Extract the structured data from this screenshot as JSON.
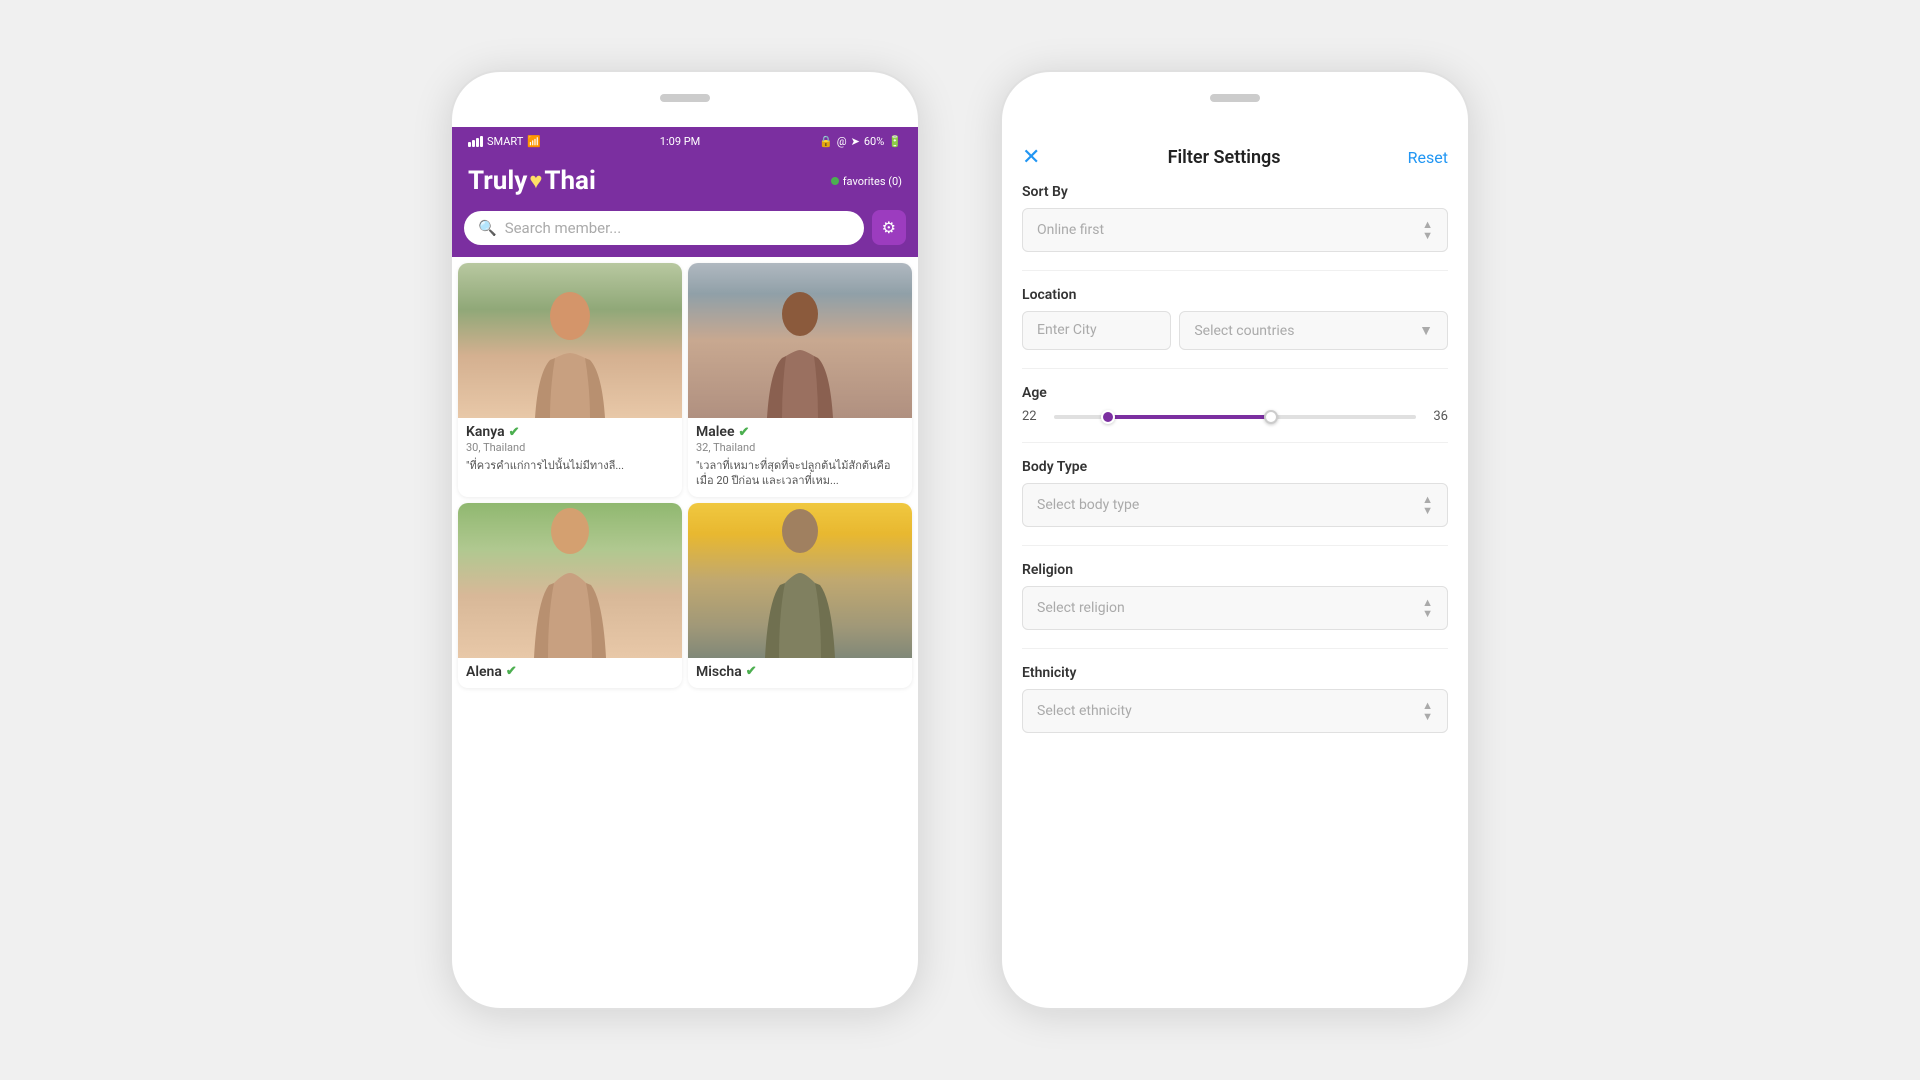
{
  "app": {
    "name": "TrulyThai",
    "logo_heart": "♥"
  },
  "left_phone": {
    "status_bar": {
      "carrier": "SMART",
      "time": "1:09 PM",
      "battery": "60%"
    },
    "favorites_label": "favorites (0)",
    "search_placeholder": "Search member...",
    "members": [
      {
        "name": "Kanya",
        "age": 30,
        "location": "Thailand",
        "verified": true,
        "quote": "\"ที่ควรคำแก่การไปนั้นไม่มีทางลี...",
        "photo_label": "kanya"
      },
      {
        "name": "Malee",
        "age": 32,
        "location": "Thailand",
        "verified": true,
        "quote": "\"เวลาที่เหมาะที่สุดที่จะปลูกต้นไม้สักต้นคือเมื่อ 20 ปีก่อน และเวลาที่เหม...",
        "photo_label": "malee"
      },
      {
        "name": "Alena",
        "age": null,
        "location": null,
        "verified": true,
        "quote": "",
        "photo_label": "alena"
      },
      {
        "name": "Mischa",
        "age": null,
        "location": null,
        "verified": true,
        "quote": "",
        "photo_label": "mischa"
      }
    ]
  },
  "right_phone": {
    "title": "Filter Settings",
    "close_icon": "✕",
    "reset_label": "Reset",
    "sections": {
      "sort_by": {
        "label": "Sort By",
        "value": "Online first",
        "placeholder": "Online first"
      },
      "location": {
        "label": "Location",
        "city_placeholder": "Enter City",
        "country_placeholder": "Select countries"
      },
      "age": {
        "label": "Age",
        "min": 22,
        "max": 36,
        "range_min": 22,
        "range_max": 36
      },
      "body_type": {
        "label": "Body Type",
        "placeholder": "Select body type"
      },
      "religion": {
        "label": "Religion",
        "placeholder": "Select religion"
      },
      "ethnicity": {
        "label": "Ethnicity",
        "placeholder": "Select ethnicity"
      }
    }
  }
}
